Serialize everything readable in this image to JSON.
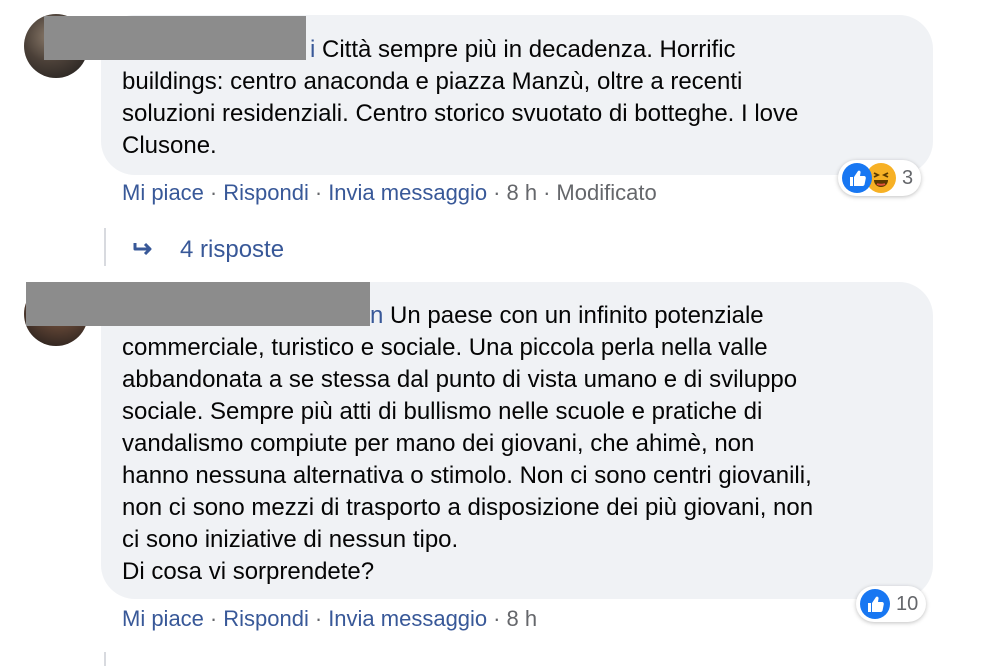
{
  "comments": [
    {
      "author_visible": "i",
      "text": "Città sempre più in decadenza. Horrific buildings: centro anaconda e piazza Manzù, oltre a recenti soluzioni residenziali. Centro storico svuotato di botteghe. I love Clusone.",
      "lines": [
        "Città sempre più in decadenza. Horrific",
        "buildings: centro anaconda e piazza Manzù, oltre a recenti",
        "soluzioni residenziali. Centro storico svuotato di botteghe. I love",
        "Clusone."
      ],
      "actions": {
        "like": "Mi piace",
        "reply": "Rispondi",
        "message": "Invia messaggio",
        "time": "8 h",
        "edited": "Modificato"
      },
      "reactions": {
        "types": [
          "like-icon",
          "haha-icon"
        ],
        "count": "3"
      },
      "replies_label": "4 risposte"
    },
    {
      "author_visible": "n",
      "lines": [
        "Un paese con un infinito potenziale",
        "commerciale, turistico e sociale. Una piccola perla nella valle",
        "abbandonata a se stessa dal punto di vista umano e di sviluppo",
        "sociale. Sempre più atti di bullismo nelle scuole e pratiche di",
        "vandalismo compiute per mano dei giovani, che ahimè, non",
        "hanno nessuna alternativa o stimolo. Non ci sono centri giovanili,",
        "non ci sono mezzi di trasporto a disposizione dei più giovani, non",
        "ci sono iniziative di nessun tipo.",
        "Di cosa vi sorprendete?"
      ],
      "actions": {
        "like": "Mi piace",
        "reply": "Rispondi",
        "message": "Invia messaggio",
        "time": "8 h"
      },
      "reactions": {
        "types": [
          "like-icon"
        ],
        "count": "10"
      }
    }
  ],
  "separator": "·",
  "colors": {
    "link": "#385898",
    "meta": "#65676b",
    "bubble": "#f0f2f5",
    "like": "#1877f2",
    "haha": "#f7b125"
  }
}
